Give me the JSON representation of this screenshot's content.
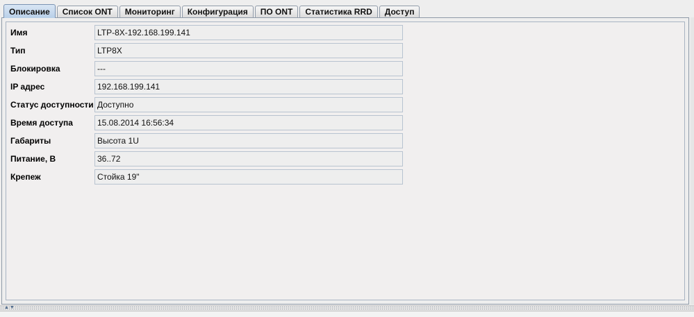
{
  "tabs": [
    {
      "label": "Описание",
      "active": true
    },
    {
      "label": "Список ONT",
      "active": false
    },
    {
      "label": "Мониторинг",
      "active": false
    },
    {
      "label": "Конфигурация",
      "active": false
    },
    {
      "label": "ПО ONT",
      "active": false
    },
    {
      "label": "Статистика RRD",
      "active": false
    },
    {
      "label": "Доступ",
      "active": false
    }
  ],
  "properties": [
    {
      "label": "Имя",
      "value": "LTP-8X-192.168.199.141"
    },
    {
      "label": "Тип",
      "value": "LTP8X"
    },
    {
      "label": "Блокировка",
      "value": "---"
    },
    {
      "label": "IP адрес",
      "value": "192.168.199.141"
    },
    {
      "label": "Статус доступности",
      "value": "Доступно"
    },
    {
      "label": "Время доступа",
      "value": "15.08.2014 16:56:34"
    },
    {
      "label": "Габариты",
      "value": "Высота 1U"
    },
    {
      "label": "Питание, В",
      "value": "36..72"
    },
    {
      "label": "Крепеж",
      "value": "Стойка 19\""
    }
  ],
  "divider": {
    "arrows": "▲▼"
  }
}
